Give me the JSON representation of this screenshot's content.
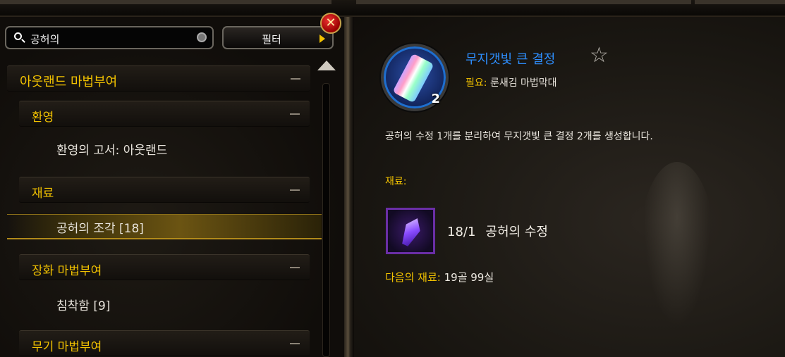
{
  "search": {
    "value": "공허의"
  },
  "filter": {
    "label": "필터"
  },
  "close": {
    "glyph": "✕"
  },
  "categories": [
    {
      "label": "아웃랜드 마법부여"
    },
    {
      "label": "환영"
    },
    {
      "label": "재료"
    },
    {
      "label": "장화 마법부여"
    },
    {
      "label": "무기 마법부여"
    }
  ],
  "items": [
    {
      "label": "환영의 고서: 아웃랜드"
    },
    {
      "label": "공허의 조각 [18]"
    },
    {
      "label": "침착함 [9]"
    }
  ],
  "recipe": {
    "name": "무지갯빛 큰 결정",
    "count": "2",
    "requires_key": "필요:",
    "requires_value": "룬새김 마법막대",
    "description": "공허의 수정 1개를 분리하여 무지갯빛 큰 결정 2개를 생성합니다.",
    "materials_label": "재료:",
    "reagent_count": "18/1",
    "reagent_name": "공허의 수정",
    "cost_key": "다음의 재료:",
    "cost_value": "19골 99실"
  },
  "icons": {
    "search": "search-icon",
    "clear": "clear-icon",
    "filter_arrow": "arrow-right-icon",
    "close": "close-icon",
    "favorite": "star-icon",
    "collapse": "minus-icon",
    "scroll_up": "arrow-up-icon"
  },
  "colors": {
    "category": "#f2c200",
    "recipe_name": "#2e8fff",
    "selected": "#6b5412"
  }
}
